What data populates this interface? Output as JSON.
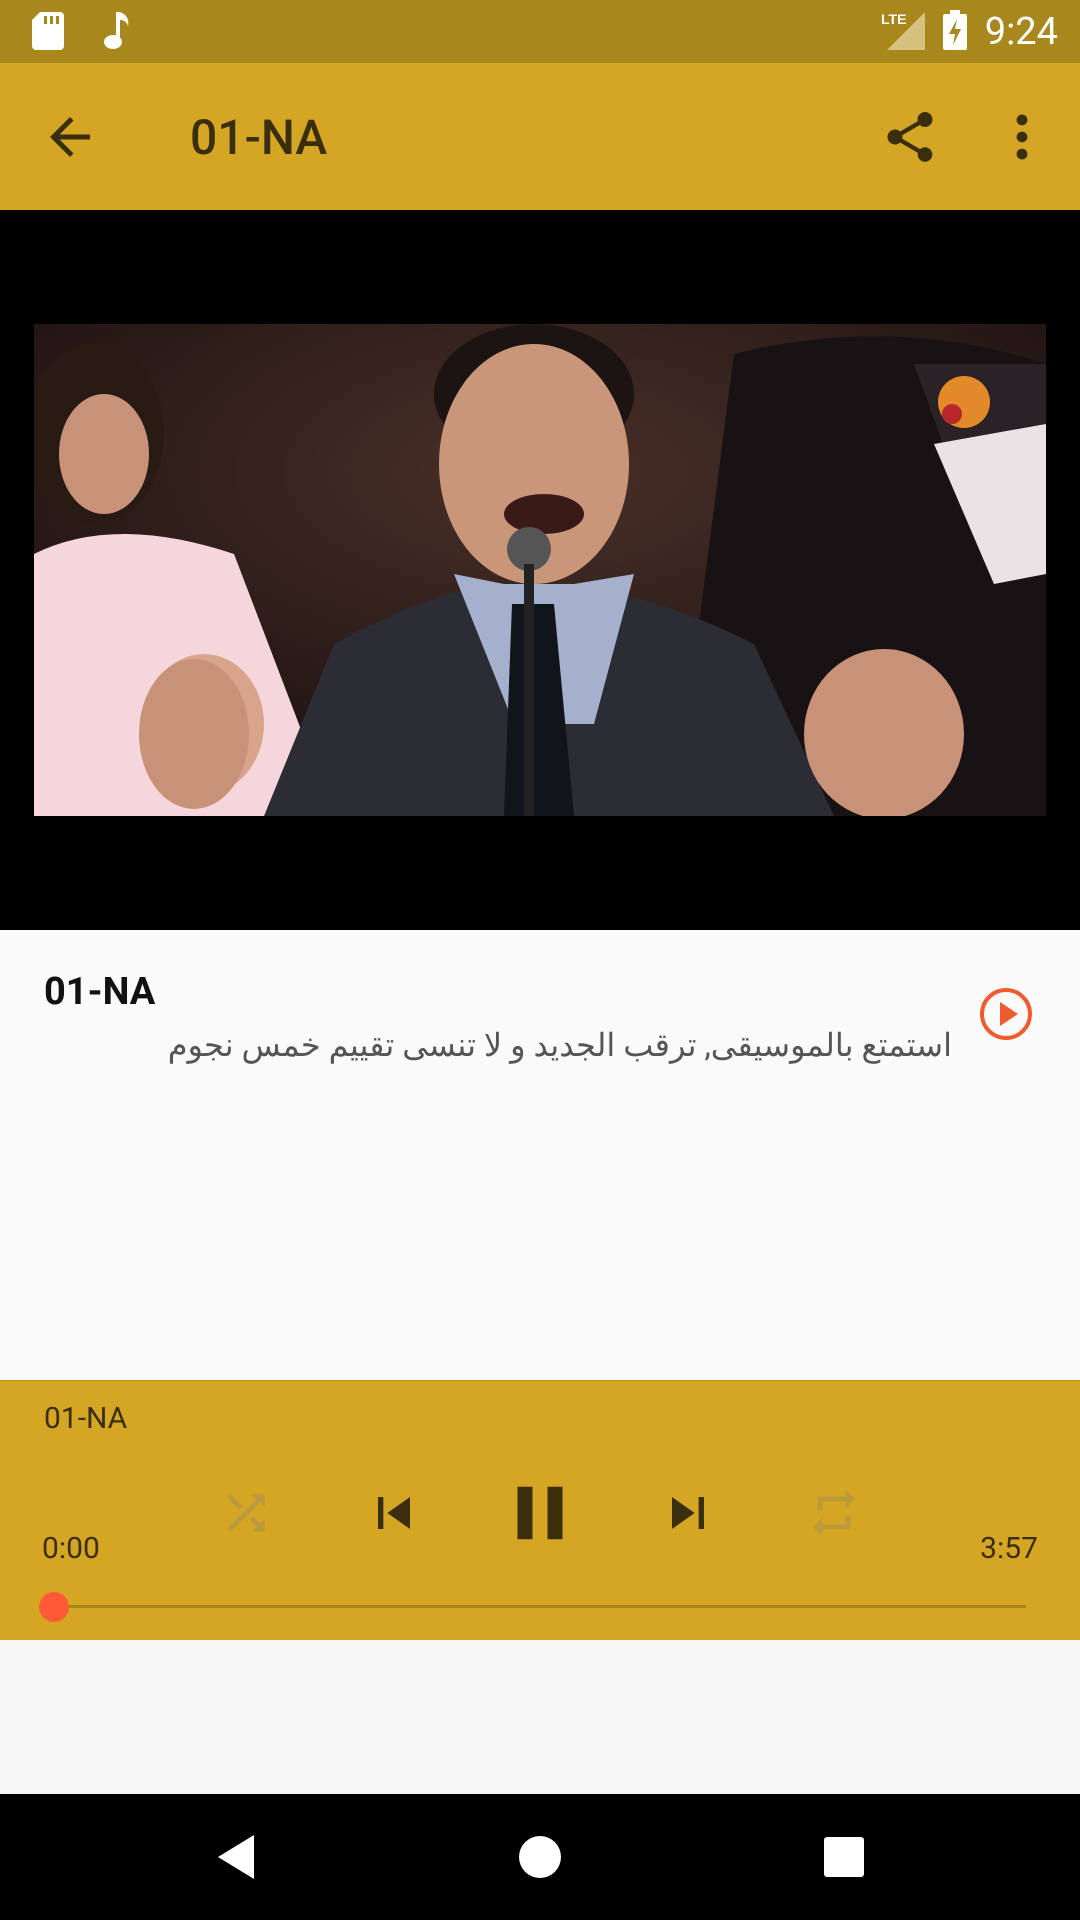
{
  "status_bar": {
    "time": "9:24",
    "network": "LTE",
    "icons": [
      "sd-card-icon",
      "music-note-icon",
      "signal-icon",
      "battery-charging-icon"
    ]
  },
  "app_bar": {
    "title": "01-NA",
    "back_icon": "arrow-back-icon",
    "share_icon": "share-icon",
    "more_icon": "more-vert-icon"
  },
  "content": {
    "track_title": "01-NA",
    "description": "استمتع بالموسيقى, ترقب الجديد و لا تنسى تقييم خمس نجوم"
  },
  "player": {
    "title": "01-NA",
    "current_time": "0:00",
    "total_time": "3:57",
    "progress": 0.0,
    "state": "playing",
    "controls": [
      "shuffle-icon",
      "skip-previous-icon",
      "pause-icon",
      "skip-next-icon",
      "repeat-icon"
    ]
  },
  "colors": {
    "status_bar": "#a8871c",
    "accent": "#d4a623",
    "thumb": "#ff5a36",
    "play_icon": "#ef5a2f"
  }
}
